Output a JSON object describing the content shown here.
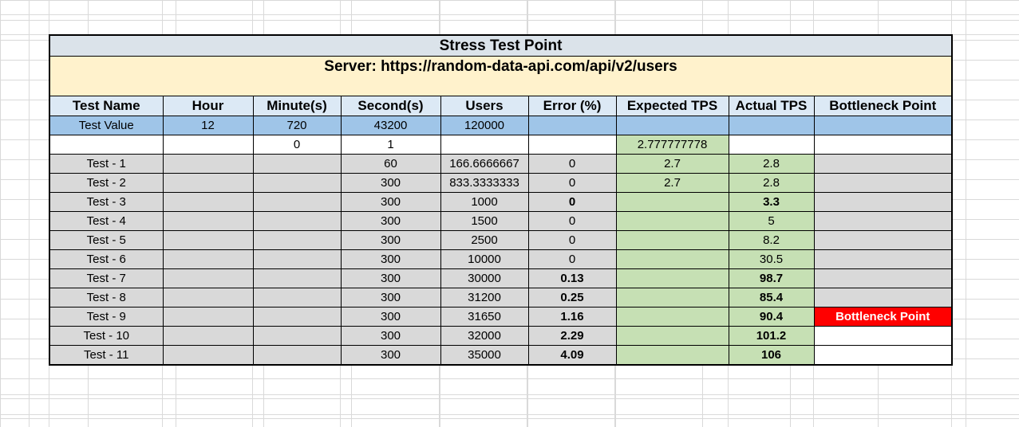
{
  "sheet": {
    "title": "Stress Test Point",
    "server": "Server: https://random-data-api.com/api/v2/users",
    "headers": [
      "Test Name",
      "Hour",
      "Minute(s)",
      "Second(s)",
      "Users",
      "Error (%)",
      "Expected TPS",
      "Actual TPS",
      "Bottleneck Point"
    ],
    "value_row": [
      "Test Value",
      "12",
      "720",
      "43200",
      "120000",
      "",
      "",
      "",
      ""
    ],
    "calc_row": [
      "",
      "",
      "0",
      "1",
      "",
      "",
      "2.777777778",
      "",
      ""
    ],
    "rows": [
      {
        "name": "Test - 1",
        "hour": "",
        "minutes": "",
        "seconds": "60",
        "users": "166.6666667",
        "error": "0",
        "expected": "2.7",
        "actual": "2.8",
        "bottleneck": "",
        "error_bold": false,
        "actual_bold": false
      },
      {
        "name": "Test - 2",
        "hour": "",
        "minutes": "",
        "seconds": "300",
        "users": "833.3333333",
        "error": "0",
        "expected": "2.7",
        "actual": "2.8",
        "bottleneck": "",
        "error_bold": false,
        "actual_bold": false
      },
      {
        "name": "Test - 3",
        "hour": "",
        "minutes": "",
        "seconds": "300",
        "users": "1000",
        "error": "0",
        "expected": "",
        "actual": "3.3",
        "bottleneck": "",
        "error_bold": true,
        "actual_bold": true
      },
      {
        "name": "Test - 4",
        "hour": "",
        "minutes": "",
        "seconds": "300",
        "users": "1500",
        "error": "0",
        "expected": "",
        "actual": "5",
        "bottleneck": "",
        "error_bold": false,
        "actual_bold": false
      },
      {
        "name": "Test - 5",
        "hour": "",
        "minutes": "",
        "seconds": "300",
        "users": "2500",
        "error": "0",
        "expected": "",
        "actual": "8.2",
        "bottleneck": "",
        "error_bold": false,
        "actual_bold": false
      },
      {
        "name": "Test - 6",
        "hour": "",
        "minutes": "",
        "seconds": "300",
        "users": "10000",
        "error": "0",
        "expected": "",
        "actual": "30.5",
        "bottleneck": "",
        "error_bold": false,
        "actual_bold": false
      },
      {
        "name": "Test - 7",
        "hour": "",
        "minutes": "",
        "seconds": "300",
        "users": "30000",
        "error": "0.13",
        "expected": "",
        "actual": "98.7",
        "bottleneck": "",
        "error_bold": true,
        "actual_bold": true
      },
      {
        "name": "Test - 8",
        "hour": "",
        "minutes": "",
        "seconds": "300",
        "users": "31200",
        "error": "0.25",
        "expected": "",
        "actual": "85.4",
        "bottleneck": "",
        "error_bold": true,
        "actual_bold": true
      },
      {
        "name": "Test - 9",
        "hour": "",
        "minutes": "",
        "seconds": "300",
        "users": "31650",
        "error": "1.16",
        "expected": "",
        "actual": "90.4",
        "bottleneck": "Bottleneck Point",
        "error_bold": true,
        "actual_bold": true
      },
      {
        "name": "Test - 10",
        "hour": "",
        "minutes": "",
        "seconds": "300",
        "users": "32000",
        "error": "2.29",
        "expected": "",
        "actual": "101.2",
        "bottleneck": "",
        "error_bold": true,
        "actual_bold": true
      },
      {
        "name": "Test - 11",
        "hour": "",
        "minutes": "",
        "seconds": "300",
        "users": "35000",
        "error": "4.09",
        "expected": "",
        "actual": "106",
        "bottleneck": "",
        "error_bold": true,
        "actual_bold": true
      }
    ]
  }
}
